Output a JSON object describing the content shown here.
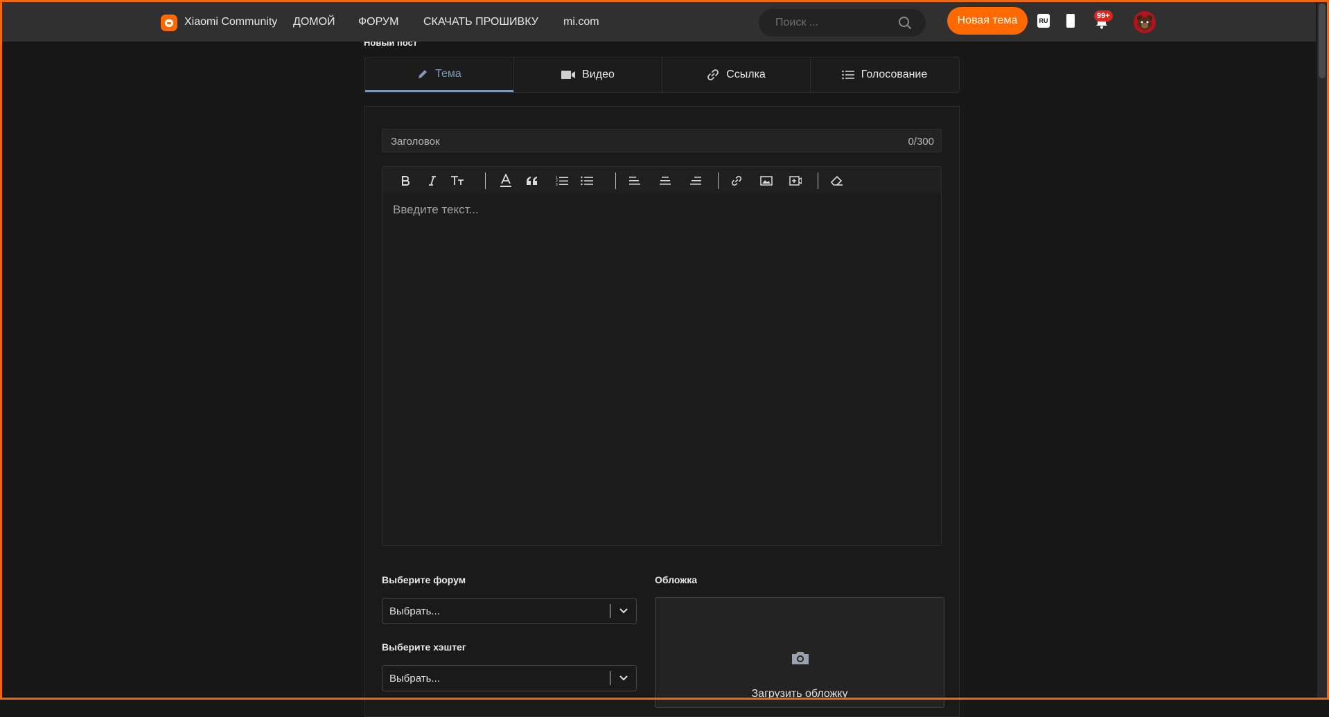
{
  "header": {
    "brand": "Xiaomi Community",
    "nav": [
      "ДОМОЙ",
      "ФОРУМ",
      "СКАЧАТЬ ПРОШИВКУ",
      "mi.com"
    ],
    "search_placeholder": "Поиск ...",
    "new_topic_label": "Новая тема",
    "lang_label": "RU",
    "notifications_badge": "99+",
    "accent_color": "#ff6900"
  },
  "page_title": "Новый пост",
  "tabs": [
    {
      "label": "Тема",
      "icon": "pencil-icon",
      "active": true
    },
    {
      "label": "Видео",
      "icon": "video-icon",
      "active": false
    },
    {
      "label": "Ссылка",
      "icon": "link-icon",
      "active": false
    },
    {
      "label": "Голосование",
      "icon": "list-icon",
      "active": false
    }
  ],
  "form": {
    "title_placeholder": "Заголовок",
    "title_counter": "0/300",
    "editor_placeholder": "Введите текст...",
    "toolbar": [
      "bold-icon",
      "italic-icon",
      "font-size-icon",
      "text-color-icon",
      "quote-icon",
      "ordered-list-icon",
      "bullet-list-icon",
      "align-left-icon",
      "align-center-icon",
      "align-right-icon",
      "link-icon",
      "image-icon",
      "video-insert-icon",
      "eraser-icon"
    ],
    "forum_label": "Выберите форум",
    "forum_value": "Выбрать...",
    "hashtag_label": "Выберите хэштег",
    "hashtag_value": "Выбрать...",
    "cover_label": "Обложка",
    "cover_upload_label": "Загрузить обложку"
  }
}
